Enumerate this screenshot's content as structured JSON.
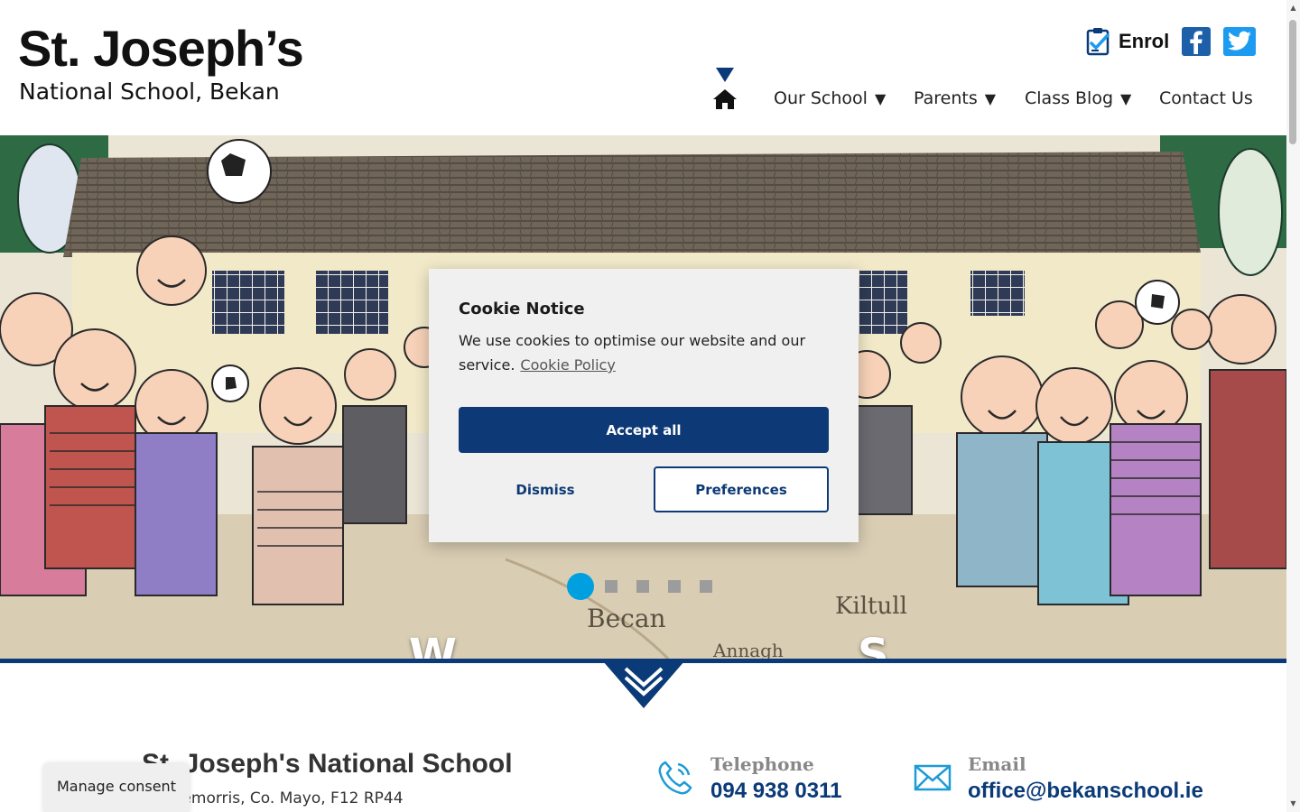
{
  "header": {
    "logo_title": "St. Joseph’s",
    "logo_subtitle": "National School, Bekan",
    "enrol_label": "Enrol"
  },
  "nav": {
    "items": [
      {
        "label": "Our School",
        "has_dropdown": true
      },
      {
        "label": "Parents",
        "has_dropdown": true
      },
      {
        "label": "Class Blog",
        "has_dropdown": true
      },
      {
        "label": "Contact Us",
        "has_dropdown": false
      }
    ],
    "dropdown_arrow": "▼"
  },
  "hero": {
    "caption_left": "W",
    "caption_right": "S",
    "slide_count": 5,
    "active_slide": 1
  },
  "cookie": {
    "title": "Cookie Notice",
    "text": "We use cookies to optimise our website and our service.",
    "policy_link": "Cookie Policy",
    "accept_label": "Accept all",
    "dismiss_label": "Dismiss",
    "preferences_label": "Preferences"
  },
  "contact": {
    "school_name": "St. Joseph's National School",
    "address": ", Claremorris, Co. Mayo, F12 RP44",
    "telephone_label": "Telephone",
    "telephone_value": "094 938 0311",
    "email_label": "Email",
    "email_value": "office@bekanschool.ie"
  },
  "manage_consent_label": "Manage consent",
  "colors": {
    "brand_navy": "#0a3a78",
    "slide_dot_active": "#00a0e0",
    "facebook": "#1d5fa8",
    "twitter": "#1d9bf0"
  },
  "icons": [
    "enrol-clipboard-icon",
    "facebook-icon",
    "twitter-icon",
    "home-icon",
    "phone-icon",
    "email-icon",
    "chevron-down-icon"
  ]
}
